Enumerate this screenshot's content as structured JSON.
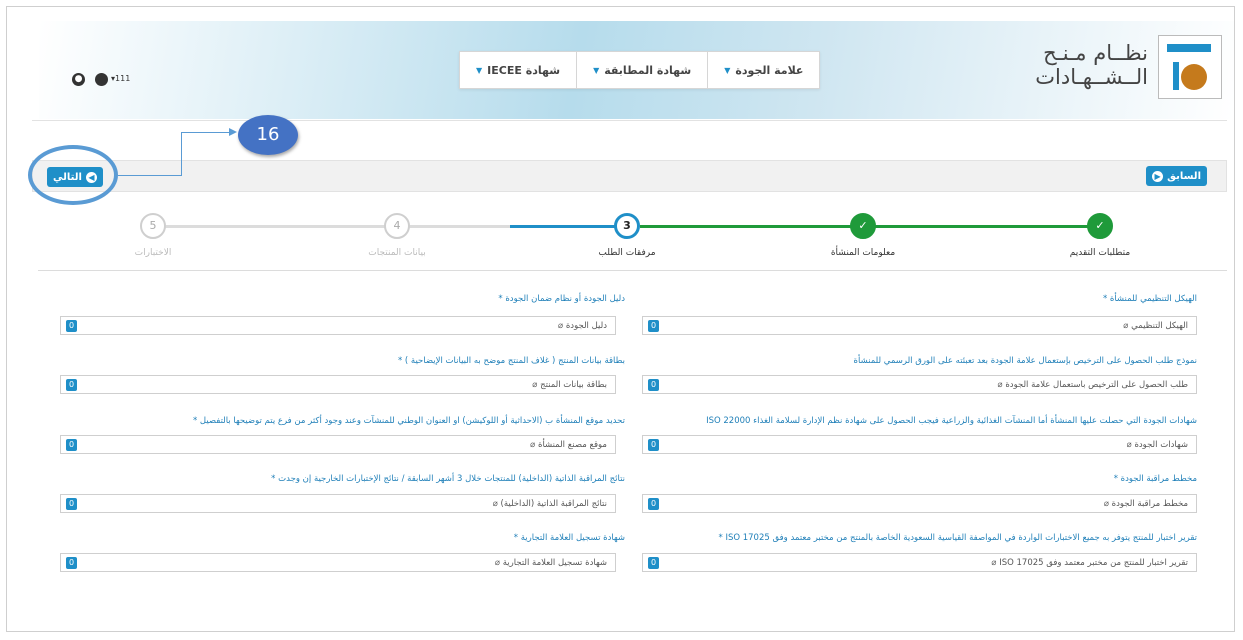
{
  "header": {
    "logo_line1": "نظــام مـنـح",
    "logo_line2": "الــشــهـادات",
    "nav": [
      {
        "label": "علامة الجودة"
      },
      {
        "label": "شهادة المطابقة"
      },
      {
        "label": "شهادة IECEE"
      }
    ],
    "user_name": "111"
  },
  "callout": {
    "number": "16"
  },
  "buttons": {
    "next_label": "التالي",
    "prev_label": "السابق"
  },
  "steps": [
    {
      "number": "",
      "label": "متطلبات التقديم",
      "state": "done"
    },
    {
      "number": "",
      "label": "معلومات المنشأة",
      "state": "done"
    },
    {
      "number": "3",
      "label": "مرفقات الطلب",
      "state": "current"
    },
    {
      "number": "4",
      "label": "بيانات المنتجات",
      "state": "future"
    },
    {
      "number": "5",
      "label": "الاختبارات",
      "state": "future"
    }
  ],
  "fields_right": [
    {
      "label": "الهيكل التنظيمي للمنشأة *",
      "value": "الهيكل التنظيمي",
      "count": "0"
    },
    {
      "label": "نموذج طلب الحصول على الترخيص بإستعمال علامة الجودة بعد تعبئته على الورق الرسمي للمنشأة",
      "value": "طلب الحصول على الترخيص باستعمال علامة الجودة",
      "count": "0"
    },
    {
      "label": "شهادات الجودة التي حصلت عليها المنشأة أما المنشآت الغذائية والزراعية فيجب الحصول على شهادة نظم الإدارة لسلامة الغذاء ISO 22000",
      "value": "شهادات الجودة",
      "count": "0"
    },
    {
      "label": "مخطط مراقبة الجودة *",
      "value": "مخطط مراقبة الجودة",
      "count": "0"
    },
    {
      "label": "تقرير اختبار للمنتج يتوفر به جميع الاختبارات الواردة في المواصفة القياسية السعودية الخاصة بالمنتج من مختبر معتمد وفق ISO 17025 *",
      "value": "تقرير اختبار للمنتج من مختبر معتمد وفق ISO 17025",
      "count": "0"
    }
  ],
  "fields_left": [
    {
      "label": "دليل الجودة أو نظام ضمان الجودة *",
      "value": "دليل الجودة",
      "count": "0"
    },
    {
      "label": "بطاقة بيانات المنتج ( غلاف المنتج موضح به البيانات الإيضاحية ) *",
      "value": "بطاقة بيانات المنتج",
      "count": "0"
    },
    {
      "label": "تحديد موقع المنشأة ب (الاحداثية أو اللوكيشن) او العنوان الوطني للمنشآت وعند وجود أكثر من فرع يتم توضيحها بالتفصيل *",
      "value": "موقع مصنع المنشأة",
      "count": "0"
    },
    {
      "label": "نتائج المراقبة الذاتية (الداخلية) للمنتجات خلال 3 أشهر السابقة / نتائج الإختبارات الخارجية إن وجدت *",
      "value": "نتائج المراقبة الذاتية (الداخلية)",
      "count": "0"
    },
    {
      "label": "شهادة تسجيل العلامة التجارية *",
      "value": "شهادة تسجيل العلامة التجارية",
      "count": "0"
    }
  ],
  "colors": {
    "accent": "#1f8fc8",
    "done": "#1f9a3a",
    "callout": "#4472c4"
  },
  "icons": [
    "globe-icon",
    "user-icon",
    "logo-icon",
    "chevron-down-icon",
    "arrow-left-circle-icon",
    "arrow-right-circle-icon",
    "check-icon",
    "paperclip-icon"
  ]
}
